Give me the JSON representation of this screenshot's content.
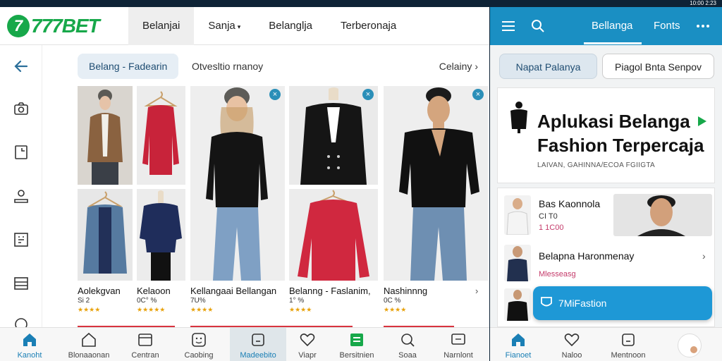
{
  "status": {
    "time": "10:00 2:23"
  },
  "brand": {
    "logo_mark": "7",
    "logo_text": "777BET",
    "color": "#17a84a"
  },
  "topnav": [
    {
      "label": "Belanjai",
      "active": true
    },
    {
      "label": "Sanja",
      "caret": "▾"
    },
    {
      "label": "Belanglja"
    },
    {
      "label": "Terberonaja"
    }
  ],
  "leftrail": {
    "icons": [
      "back-arrow-icon",
      "camera-icon",
      "note-icon",
      "user-icon",
      "grid-icon",
      "list-icon",
      "pin-icon"
    ]
  },
  "subbar": {
    "pill": "Belang - Fadearin",
    "middle": "Otvesltio rnanoy",
    "right": "Celainy",
    "chevron": "›"
  },
  "products": [
    {
      "name": "Aolekgvan",
      "price": "Si 2",
      "stars": "★★★★"
    },
    {
      "name": "Kelaoon",
      "price": "0C° %",
      "stars": "★★★★★"
    },
    {
      "name": "Kellangaai Bellangan",
      "price": "7U%",
      "stars": "★★★★"
    },
    {
      "name": "Belanng - Faslanim,",
      "price": "1° %",
      "stars": "★★★★"
    },
    {
      "name": "Nashinnng",
      "price": "0C %",
      "stars": "★★★★"
    }
  ],
  "close_glyph": "×",
  "more_arrow": "›",
  "bottomnav": [
    {
      "label": "Kanoht",
      "icon": "home-icon",
      "active": true
    },
    {
      "label": "Blonaaonan",
      "icon": "house-icon"
    },
    {
      "label": "Centran",
      "icon": "window-icon"
    },
    {
      "label": "Caobing",
      "icon": "smile-icon"
    },
    {
      "label": "Madeebito",
      "icon": "square-icon",
      "highlight": true
    },
    {
      "label": "Viapr",
      "icon": "heart-icon"
    },
    {
      "label": "Bersitnien",
      "icon": "doc-icon"
    },
    {
      "label": "Soaa",
      "icon": "search-icon"
    },
    {
      "label": "Narnlont",
      "icon": "chat-icon"
    }
  ],
  "right": {
    "tabs": {
      "active": "Bellanga",
      "other": "Fonts"
    },
    "btn_left": "Napat Palanya",
    "btn_right": "Piagol Bnta Senpov",
    "headline_1": "Aplukasi Belanga",
    "headline_2": "Fashion Terpercaja",
    "tagline": "LAIVAN, GAHINNA/ECOA FGIIGTA",
    "row1_title": "Bas Kaonnola",
    "row1_sub": "CI T0",
    "row1_price": "1 1C00",
    "row2_title": "Belapna Haronmenay",
    "row2_sub": "Mlesseasg",
    "fab_label": "7MiFastion",
    "bottom": [
      {
        "label": "Fianoet",
        "icon": "home-icon",
        "active": true
      },
      {
        "label": "Naloo",
        "icon": "heart-icon"
      },
      {
        "label": "Mentnoon",
        "icon": "square-icon"
      }
    ]
  },
  "colors": {
    "accent": "#1a8fc3",
    "brand_green": "#17a84a",
    "star": "#e8a20c",
    "badge": "#2b8fb8"
  }
}
